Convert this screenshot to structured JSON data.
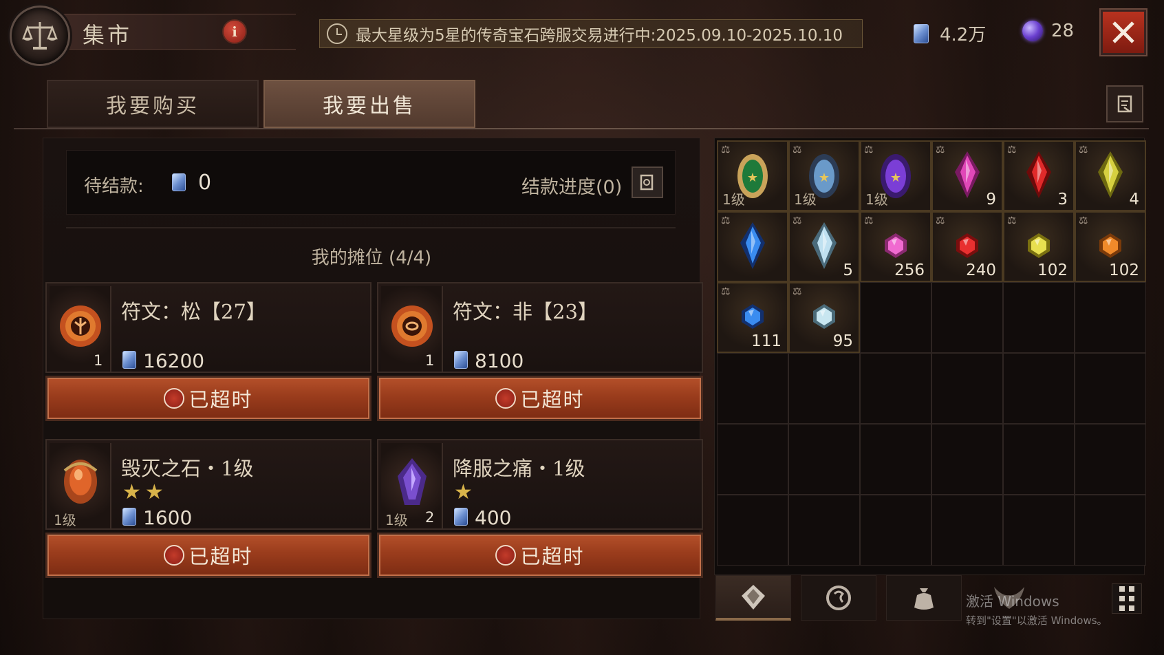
{
  "header": {
    "title": "集市",
    "info_icon": "i",
    "announcement": "最大星级为5星的传奇宝石跨服交易进行中:2025.09.10-2025.10.10",
    "currency_platinum": "4.2万",
    "currency_orb": "28",
    "colors": {
      "accent_red": "#9a3c1c",
      "close_red": "#b8321f"
    }
  },
  "tabs": [
    {
      "label": "我要购买",
      "active": false
    },
    {
      "label": "我要出售",
      "active": true
    }
  ],
  "settlement": {
    "pending_label": "待结款:",
    "pending_value": "0",
    "progress_label": "结款进度(0)"
  },
  "stalls": {
    "title": "我的摊位 (4/4)",
    "items": [
      {
        "name": "符文：松【27】",
        "qty": "1",
        "level": "",
        "stars": "",
        "price": "16200",
        "status": "已超时",
        "icon": "rune-song-icon"
      },
      {
        "name": "符文：非【23】",
        "qty": "1",
        "level": "",
        "stars": "",
        "price": "8100",
        "status": "已超时",
        "icon": "rune-fei-icon"
      },
      {
        "name": "毁灭之石・1级",
        "qty": "",
        "level": "1级",
        "stars": "★★",
        "price": "1600",
        "status": "已超时",
        "icon": "orange-legendary-gem-icon"
      },
      {
        "name": "降服之痛・1级",
        "qty": "2",
        "level": "1级",
        "stars": "★",
        "price": "400",
        "status": "已超时",
        "icon": "purple-legendary-gem-icon"
      }
    ]
  },
  "inventory": {
    "cells": [
      {
        "type": "legendary-green",
        "level": "1级",
        "count": ""
      },
      {
        "type": "legendary-blue",
        "level": "1级",
        "count": ""
      },
      {
        "type": "legendary-purple",
        "level": "1级",
        "count": ""
      },
      {
        "type": "pink-crystal",
        "level": "",
        "count": "9"
      },
      {
        "type": "red-crystal",
        "level": "",
        "count": "3"
      },
      {
        "type": "yellow-crystal",
        "level": "",
        "count": "4"
      },
      {
        "type": "blue-crystal",
        "level": "",
        "count": ""
      },
      {
        "type": "white-crystal",
        "level": "",
        "count": "5"
      },
      {
        "type": "pink-gem",
        "level": "",
        "count": "256"
      },
      {
        "type": "red-gem",
        "level": "",
        "count": "240"
      },
      {
        "type": "yellow-gem",
        "level": "",
        "count": "102"
      },
      {
        "type": "orange-gem",
        "level": "",
        "count": "102"
      },
      {
        "type": "blue-gem",
        "level": "",
        "count": "111"
      },
      {
        "type": "white-gem",
        "level": "",
        "count": "95"
      }
    ],
    "total_cells": 36
  },
  "bottom_bar": {
    "categories": [
      "gem-category-icon",
      "rune-category-icon",
      "bag-category-icon",
      "demon-category-icon"
    ]
  },
  "watermark": {
    "line1": "激活 Windows",
    "line2": "转到\"设置\"以激活 Windows。"
  }
}
